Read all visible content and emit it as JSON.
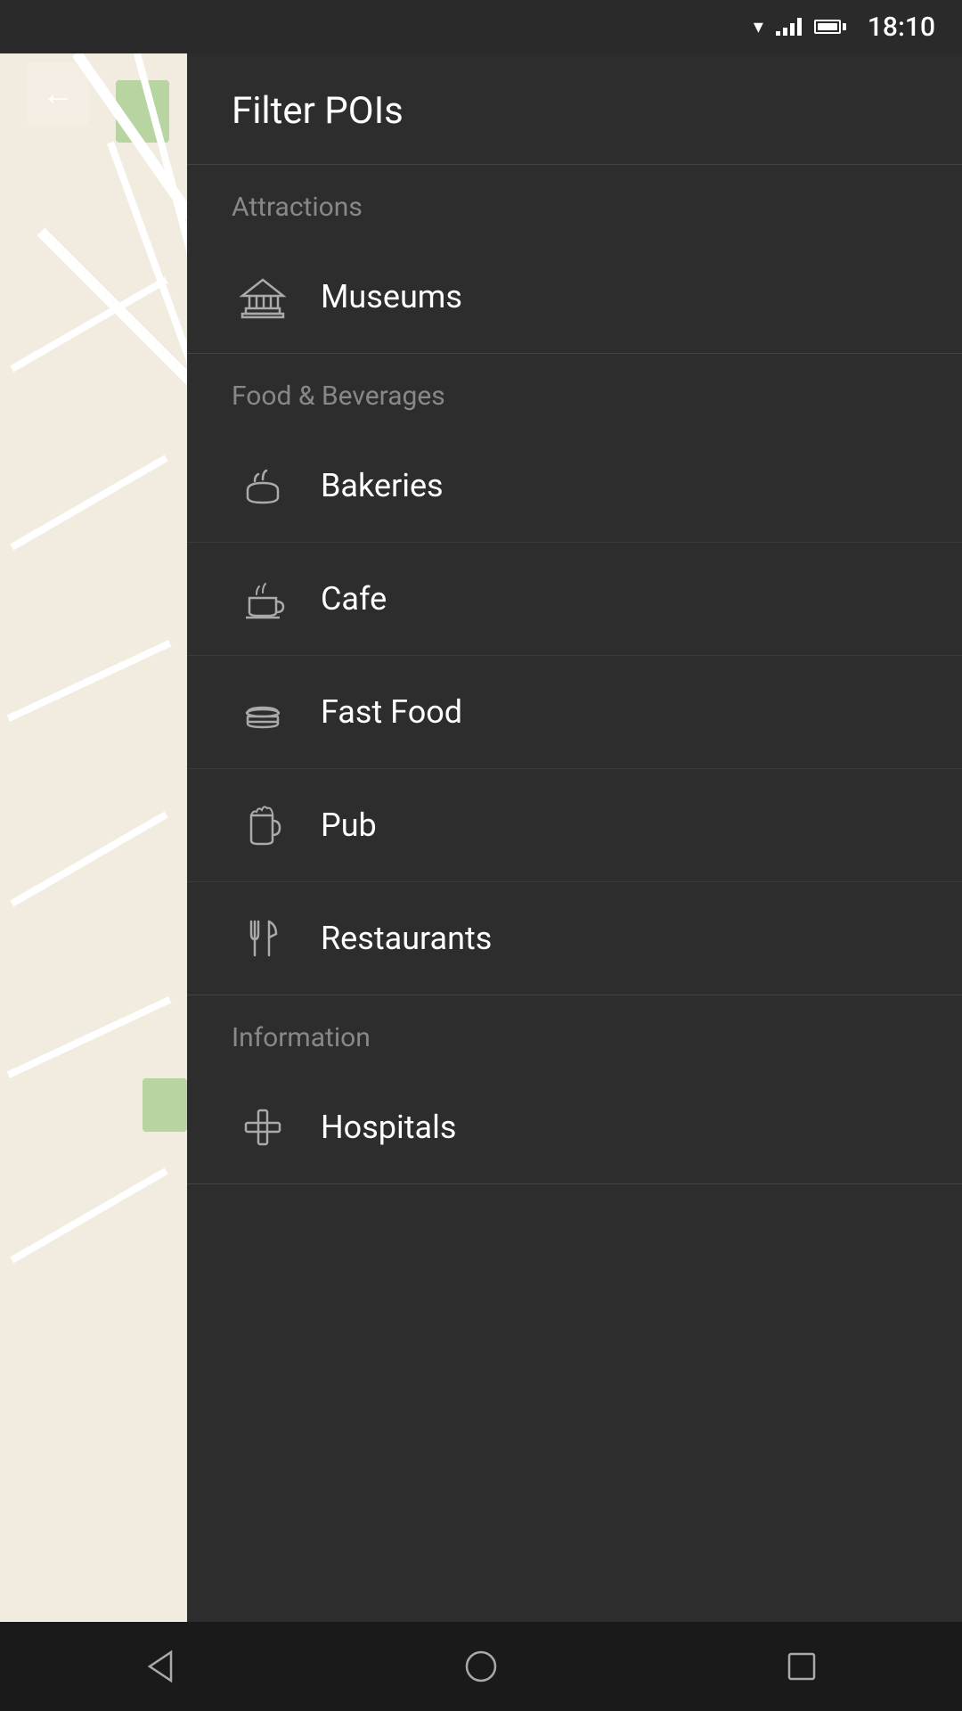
{
  "status_bar": {
    "time": "18:10"
  },
  "header": {
    "title": "Filter POIs",
    "back_label": "back"
  },
  "sections": [
    {
      "id": "attractions",
      "title": "Attractions",
      "items": [
        {
          "id": "museums",
          "label": "Museums",
          "icon": "museum"
        }
      ]
    },
    {
      "id": "food-beverages",
      "title": "Food & Beverages",
      "items": [
        {
          "id": "bakeries",
          "label": "Bakeries",
          "icon": "bakery"
        },
        {
          "id": "cafe",
          "label": "Cafe",
          "icon": "cafe"
        },
        {
          "id": "fast-food",
          "label": "Fast Food",
          "icon": "fast-food"
        },
        {
          "id": "pub",
          "label": "Pub",
          "icon": "pub"
        },
        {
          "id": "restaurants",
          "label": "Restaurants",
          "icon": "restaurant"
        }
      ]
    },
    {
      "id": "information",
      "title": "Information",
      "items": [
        {
          "id": "hospitals",
          "label": "Hospitals",
          "icon": "hospital"
        }
      ]
    }
  ],
  "bottom_nav": {
    "back_label": "back",
    "home_label": "home",
    "recents_label": "recents"
  }
}
